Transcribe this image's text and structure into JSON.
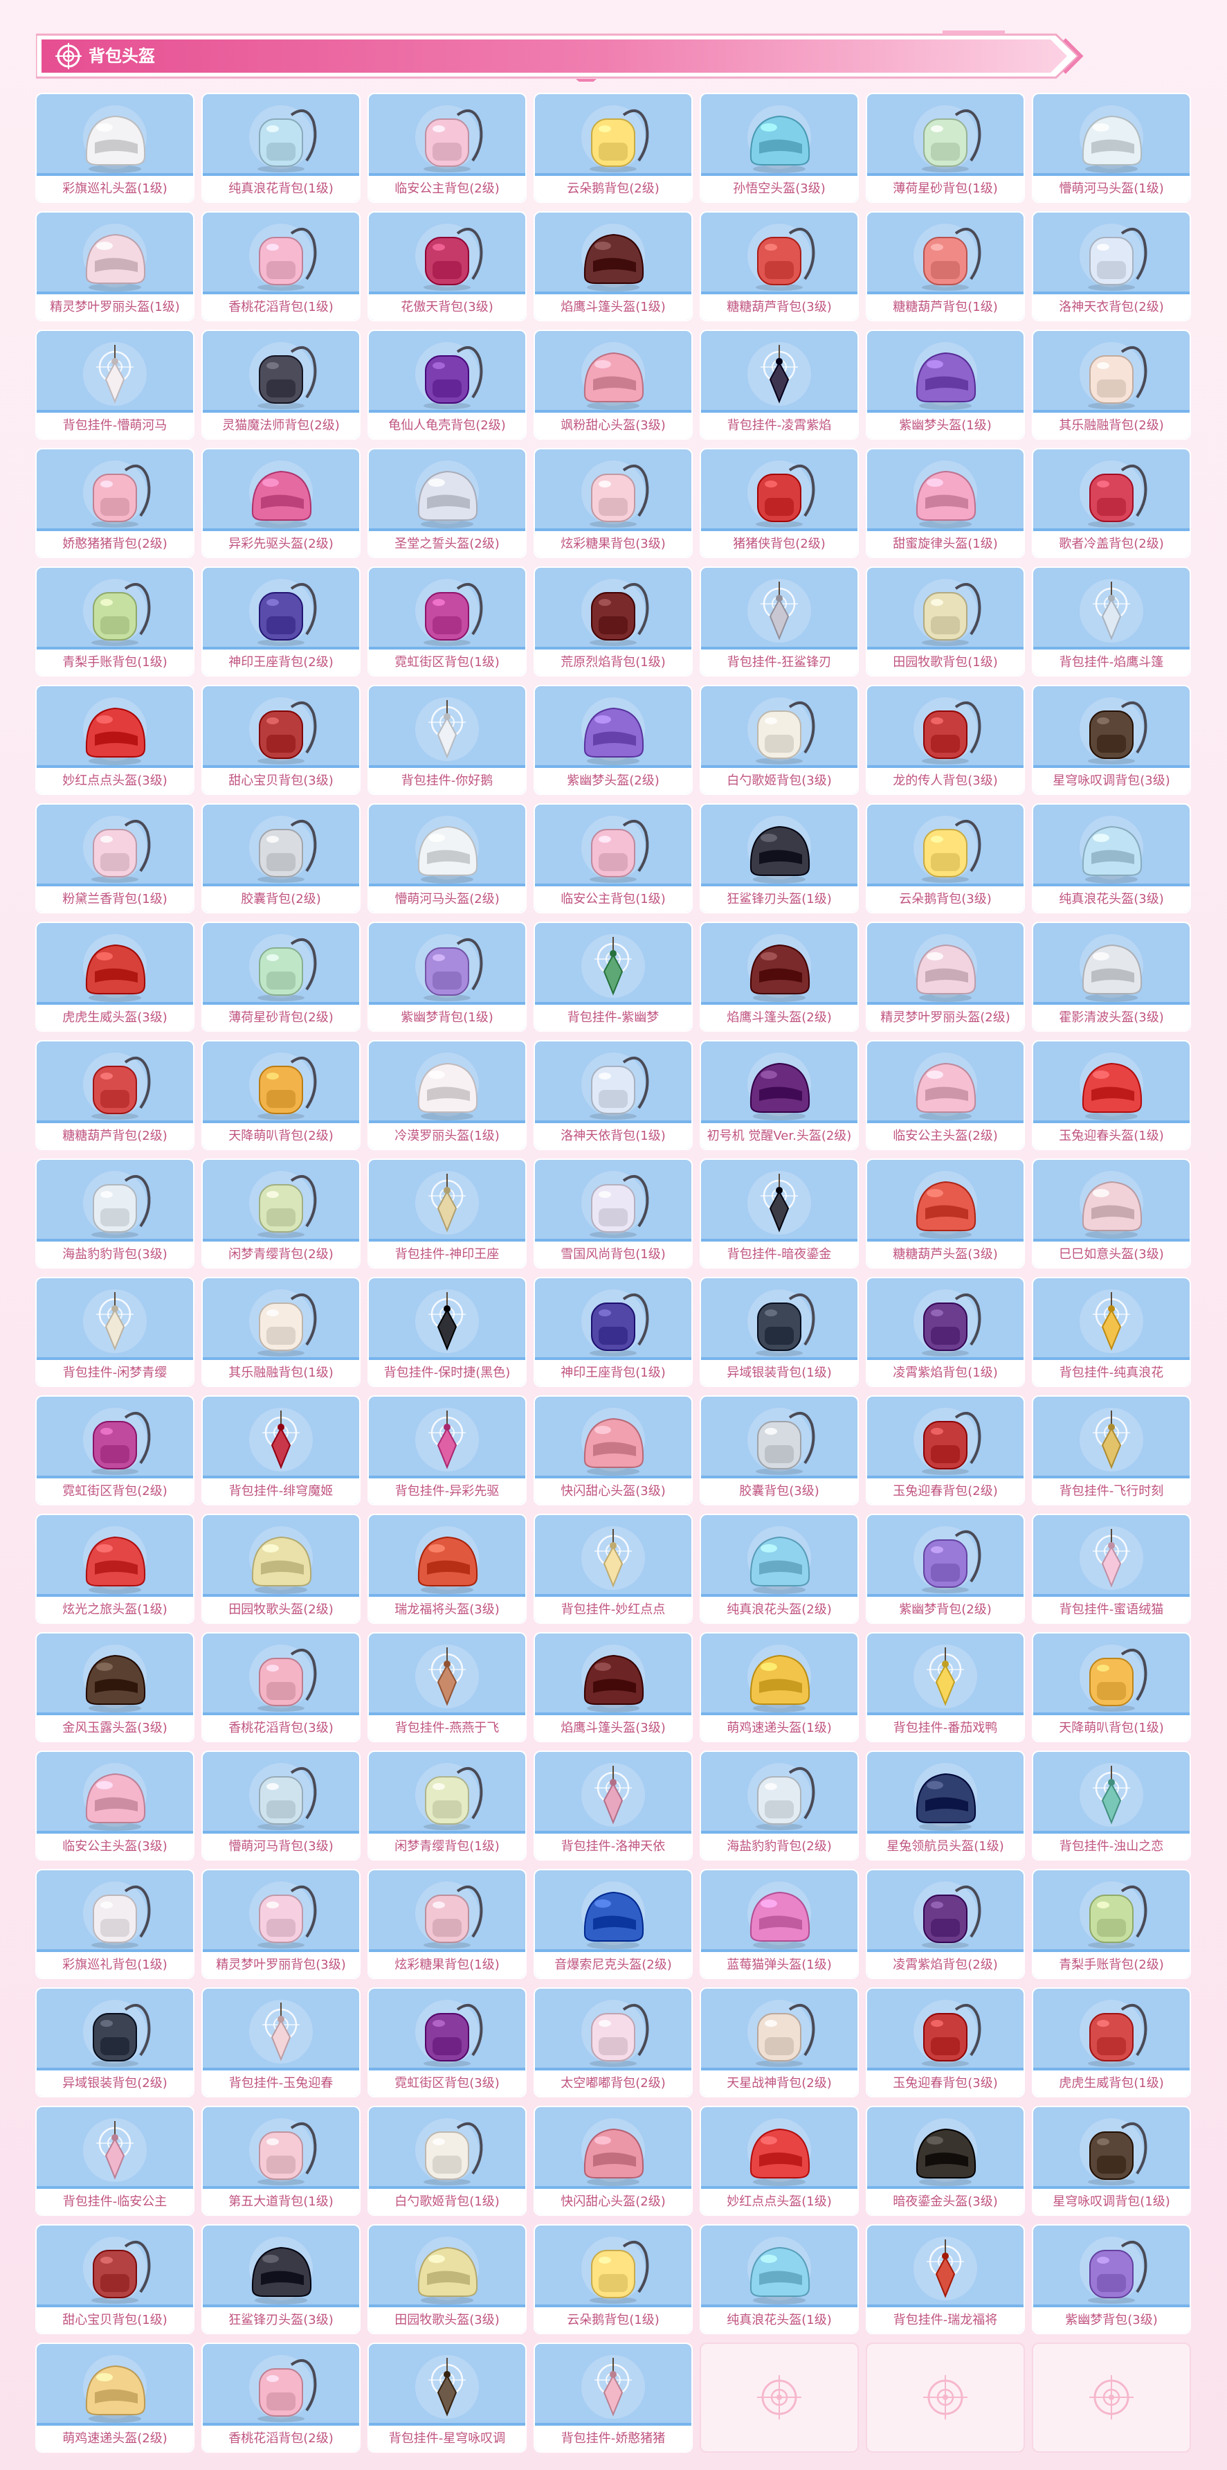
{
  "header": {
    "title": "背包头盔",
    "colors": {
      "accent": "#ee6aa3",
      "accent_light": "#ffd9e8",
      "cell_bg": "#a6cdf2",
      "label_text": "#c0547f"
    }
  },
  "items": [
    {
      "name": "彩旗巡礼头盔(1级)",
      "type": "helmet",
      "color": "#f3f3f5"
    },
    {
      "name": "纯真浪花背包(1级)",
      "type": "backpack",
      "color": "#bfe2f2"
    },
    {
      "name": "临安公主背包(2级)",
      "type": "backpack",
      "color": "#f6c6d8"
    },
    {
      "name": "云朵鹅背包(2级)",
      "type": "backpack",
      "color": "#ffe27a"
    },
    {
      "name": "孙悟空头盔(3级)",
      "type": "helmet",
      "color": "#7fd0e8"
    },
    {
      "name": "薄荷星砂背包(1级)",
      "type": "backpack",
      "color": "#cfeacc"
    },
    {
      "name": "懵萌河马头盔(1级)",
      "type": "helmet",
      "color": "#e8f2f6"
    },
    {
      "name": "精灵梦叶罗丽头盔(1级)",
      "type": "helmet",
      "color": "#f4d9e3"
    },
    {
      "name": "香桃花滔背包(1级)",
      "type": "backpack",
      "color": "#f6b9cf"
    },
    {
      "name": "花傲天背包(3级)",
      "type": "backpack",
      "color": "#c63a6a"
    },
    {
      "name": "焰鹰斗篷头盔(1级)",
      "type": "helmet",
      "color": "#6a2e2e"
    },
    {
      "name": "糖糖葫芦背包(3级)",
      "type": "backpack",
      "color": "#e0554f"
    },
    {
      "name": "糖糖葫芦背包(1级)",
      "type": "backpack",
      "color": "#f08a86"
    },
    {
      "name": "洛神天衣背包(2级)",
      "type": "backpack",
      "color": "#dfe9f7"
    },
    {
      "name": "背包挂件-懵萌河马",
      "type": "charm",
      "color": "#f6eff2"
    },
    {
      "name": "灵猫魔法师背包(2级)",
      "type": "backpack",
      "color": "#4c4c5a"
    },
    {
      "name": "龟仙人龟壳背包(2级)",
      "type": "backpack",
      "color": "#7d3fb0"
    },
    {
      "name": "飒粉甜心头盔(3级)",
      "type": "helmet",
      "color": "#f3a6b8"
    },
    {
      "name": "背包挂件-凌霄紫焰",
      "type": "charm",
      "color": "#3d3450"
    },
    {
      "name": "紫幽梦头盔(1级)",
      "type": "helmet",
      "color": "#8e63cc"
    },
    {
      "name": "其乐融融背包(2级)",
      "type": "backpack",
      "color": "#f7e3d7"
    },
    {
      "name": "娇憨猪猪背包(2级)",
      "type": "backpack",
      "color": "#f6b8c9"
    },
    {
      "name": "异彩先驱头盔(2级)",
      "type": "helmet",
      "color": "#e56aa2"
    },
    {
      "name": "圣堂之誓头盔(2级)",
      "type": "helmet",
      "color": "#dfe3ef"
    },
    {
      "name": "炫彩糖果背包(3级)",
      "type": "backpack",
      "color": "#f7d0d9"
    },
    {
      "name": "猪猪侠背包(2级)",
      "type": "backpack",
      "color": "#d93c3c"
    },
    {
      "name": "甜蜜旋律头盔(1级)",
      "type": "helmet",
      "color": "#f5a9c6"
    },
    {
      "name": "歌者冷盖背包(2级)",
      "type": "backpack",
      "color": "#d9445a"
    },
    {
      "name": "青梨手账背包(1级)",
      "type": "backpack",
      "color": "#c6e0a2"
    },
    {
      "name": "神印王座背包(2级)",
      "type": "backpack",
      "color": "#5a4caa"
    },
    {
      "name": "霓虹街区背包(1级)",
      "type": "backpack",
      "color": "#c54aa1"
    },
    {
      "name": "荒原烈焰背包(1级)",
      "type": "backpack",
      "color": "#7a2a2a"
    },
    {
      "name": "背包挂件-狂鲨锋刃",
      "type": "charm",
      "color": "#c9c7d2"
    },
    {
      "name": "田园牧歌背包(1级)",
      "type": "backpack",
      "color": "#e9e1b9"
    },
    {
      "name": "背包挂件-焰鹰斗篷",
      "type": "charm",
      "color": "#dfe9f4"
    },
    {
      "name": "妙红点点头盔(3级)",
      "type": "helmet",
      "color": "#e23c3c"
    },
    {
      "name": "甜心宝贝背包(3级)",
      "type": "backpack",
      "color": "#b83c3c"
    },
    {
      "name": "背包挂件-你好鹅",
      "type": "charm",
      "color": "#eef2f6"
    },
    {
      "name": "紫幽梦头盔(2级)",
      "type": "helmet",
      "color": "#8f6ad4"
    },
    {
      "name": "白勺歌姬背包(3级)",
      "type": "backpack",
      "color": "#f4efe4"
    },
    {
      "name": "龙的传人背包(3级)",
      "type": "backpack",
      "color": "#c73d3d"
    },
    {
      "name": "星穹咏叹调背包(3级)",
      "type": "backpack",
      "color": "#5b4638"
    },
    {
      "name": "粉黛兰香背包(1级)",
      "type": "backpack",
      "color": "#f6d1e0"
    },
    {
      "name": "胶囊背包(2级)",
      "type": "backpack",
      "color": "#d9dde2"
    },
    {
      "name": "懵萌河马头盔(2级)",
      "type": "helmet",
      "color": "#f1f4f6"
    },
    {
      "name": "临安公主背包(1级)",
      "type": "backpack",
      "color": "#f6c0d4"
    },
    {
      "name": "狂鲨锋刃头盔(1级)",
      "type": "helmet",
      "color": "#3a3a46"
    },
    {
      "name": "云朵鹅背包(3级)",
      "type": "backpack",
      "color": "#ffe27a"
    },
    {
      "name": "纯真浪花头盔(3级)",
      "type": "helmet",
      "color": "#bfe3f4"
    },
    {
      "name": "虎虎生威头盔(3级)",
      "type": "helmet",
      "color": "#d8403a"
    },
    {
      "name": "薄荷星砂背包(2级)",
      "type": "backpack",
      "color": "#bfe6c7"
    },
    {
      "name": "紫幽梦背包(1级)",
      "type": "backpack",
      "color": "#a98bdd"
    },
    {
      "name": "背包挂件-紫幽梦",
      "type": "charm",
      "color": "#5da874"
    },
    {
      "name": "焰鹰斗篷头盔(2级)",
      "type": "helmet",
      "color": "#7a2a2a"
    },
    {
      "name": "精灵梦叶罗丽头盔(2级)",
      "type": "helmet",
      "color": "#f2d4e1"
    },
    {
      "name": "霍影清波头盔(3级)",
      "type": "helmet",
      "color": "#e4e7ec"
    },
    {
      "name": "糖糖葫芦背包(2级)",
      "type": "backpack",
      "color": "#d84c4c"
    },
    {
      "name": "天降萌叭背包(2级)",
      "type": "backpack",
      "color": "#f2b44a"
    },
    {
      "name": "冷漠罗丽头盔(1级)",
      "type": "helmet",
      "color": "#f7f1f4"
    },
    {
      "name": "洛神天依背包(1级)",
      "type": "backpack",
      "color": "#dfe9f7"
    },
    {
      "name": "初号机 觉醒Ver.头盔(2级)",
      "type": "helmet",
      "color": "#6a2a7e"
    },
    {
      "name": "临安公主头盔(2级)",
      "type": "helmet",
      "color": "#f6c0d2"
    },
    {
      "name": "玉兔迎春头盔(1级)",
      "type": "helmet",
      "color": "#e84343"
    },
    {
      "name": "海盐豹豹背包(3级)",
      "type": "backpack",
      "color": "#e7eef4"
    },
    {
      "name": "闲梦青缨背包(2级)",
      "type": "backpack",
      "color": "#d8e6b9"
    },
    {
      "name": "背包挂件-神印王座",
      "type": "charm",
      "color": "#e7d7a7"
    },
    {
      "name": "雪国风尚背包(1级)",
      "type": "backpack",
      "color": "#ece7f6"
    },
    {
      "name": "背包挂件-暗夜鎏金",
      "type": "charm",
      "color": "#3c3c46"
    },
    {
      "name": "糖糖葫芦头盔(3级)",
      "type": "helmet",
      "color": "#e65b4c"
    },
    {
      "name": "巳巳如意头盔(3级)",
      "type": "helmet",
      "color": "#f1d2d8"
    },
    {
      "name": "背包挂件-闲梦青缨",
      "type": "charm",
      "color": "#f1e9d8"
    },
    {
      "name": "其乐融融背包(1级)",
      "type": "backpack",
      "color": "#f6ece2"
    },
    {
      "name": "背包挂件-保时捷(黑色)",
      "type": "charm",
      "color": "#2f2f36"
    },
    {
      "name": "神印王座背包(1级)",
      "type": "backpack",
      "color": "#5247a6"
    },
    {
      "name": "异域银装背包(1级)",
      "type": "backpack",
      "color": "#3d4656"
    },
    {
      "name": "凌霄紫焰背包(1级)",
      "type": "backpack",
      "color": "#6c3d8e"
    },
    {
      "name": "背包挂件-纯真浪花",
      "type": "charm",
      "color": "#f3c24a"
    },
    {
      "name": "霓虹街区背包(2级)",
      "type": "backpack",
      "color": "#c04a9e"
    },
    {
      "name": "背包挂件-绯穹魔姬",
      "type": "charm",
      "color": "#c8374a"
    },
    {
      "name": "背包挂件-异彩先驱",
      "type": "charm",
      "color": "#e060a6"
    },
    {
      "name": "快闪甜心头盔(3级)",
      "type": "helmet",
      "color": "#f0a0ae"
    },
    {
      "name": "胶囊背包(3级)",
      "type": "backpack",
      "color": "#d6dbe1"
    },
    {
      "name": "玉兔迎春背包(2级)",
      "type": "backpack",
      "color": "#c43a3a"
    },
    {
      "name": "背包挂件-飞行时刻",
      "type": "charm",
      "color": "#e3c36a"
    },
    {
      "name": "炫光之旅头盔(1级)",
      "type": "helmet",
      "color": "#e44646"
    },
    {
      "name": "田园牧歌头盔(2级)",
      "type": "helmet",
      "color": "#e9e1a9"
    },
    {
      "name": "瑞龙福将头盔(3级)",
      "type": "helmet",
      "color": "#e0593f"
    },
    {
      "name": "背包挂件-妙红点点",
      "type": "charm",
      "color": "#f6e2a6"
    },
    {
      "name": "纯真浪花头盔(2级)",
      "type": "helmet",
      "color": "#8fd3ee"
    },
    {
      "name": "紫幽梦背包(2级)",
      "type": "backpack",
      "color": "#9a7ad8"
    },
    {
      "name": "背包挂件-蜜语绒猫",
      "type": "charm",
      "color": "#f6c7db"
    },
    {
      "name": "金风玉露头盔(3级)",
      "type": "helmet",
      "color": "#5a4030"
    },
    {
      "name": "香桃花滔背包(3级)",
      "type": "backpack",
      "color": "#f4b4c6"
    },
    {
      "name": "背包挂件-燕燕于飞",
      "type": "charm",
      "color": "#c98a6a"
    },
    {
      "name": "焰鹰斗篷头盔(3级)",
      "type": "helmet",
      "color": "#6d2424"
    },
    {
      "name": "萌鸡速递头盔(1级)",
      "type": "helmet",
      "color": "#f2c449"
    },
    {
      "name": "背包挂件-番茄戏鸭",
      "type": "charm",
      "color": "#f8d65a"
    },
    {
      "name": "天降萌叭背包(1级)",
      "type": "backpack",
      "color": "#f5bd52"
    },
    {
      "name": "临安公主头盔(3级)",
      "type": "helmet",
      "color": "#f5b6cc"
    },
    {
      "name": "懵萌河马背包(3级)",
      "type": "backpack",
      "color": "#cfe3ef"
    },
    {
      "name": "闲梦青缨背包(1级)",
      "type": "backpack",
      "color": "#e5ebc4"
    },
    {
      "name": "背包挂件-洛神天依",
      "type": "charm",
      "color": "#e9a7bf"
    },
    {
      "name": "海盐豹豹背包(2级)",
      "type": "backpack",
      "color": "#e4ecf3"
    },
    {
      "name": "星兔领航员头盔(1级)",
      "type": "helmet",
      "color": "#2f3f6f"
    },
    {
      "name": "背包挂件-浊山之恋",
      "type": "charm",
      "color": "#79c7b6"
    },
    {
      "name": "彩旗巡礼背包(1级)",
      "type": "backpack",
      "color": "#f3eef2"
    },
    {
      "name": "精灵梦叶罗丽背包(3级)",
      "type": "backpack",
      "color": "#f6d0e0"
    },
    {
      "name": "炫彩糖果背包(1级)",
      "type": "backpack",
      "color": "#f2c6d3"
    },
    {
      "name": "音爆索尼克头盔(2级)",
      "type": "helmet",
      "color": "#2f5fc6"
    },
    {
      "name": "蓝莓猫弹头盔(1级)",
      "type": "helmet",
      "color": "#e984c9"
    },
    {
      "name": "凌霄紫焰背包(2级)",
      "type": "backpack",
      "color": "#6b3b8a"
    },
    {
      "name": "青梨手账背包(2级)",
      "type": "backpack",
      "color": "#c7e0a1"
    },
    {
      "name": "异域银装背包(2级)",
      "type": "backpack",
      "color": "#3c4454"
    },
    {
      "name": "背包挂件-玉兔迎春",
      "type": "charm",
      "color": "#f2d4d9"
    },
    {
      "name": "霓虹街区背包(3级)",
      "type": "backpack",
      "color": "#8a3c9e"
    },
    {
      "name": "太空嘟嘟背包(2级)",
      "type": "backpack",
      "color": "#f6dbe8"
    },
    {
      "name": "天星战神背包(2级)",
      "type": "backpack",
      "color": "#f0e0d4"
    },
    {
      "name": "玉兔迎春背包(3级)",
      "type": "backpack",
      "color": "#c83c3c"
    },
    {
      "name": "虎虎生威背包(1级)",
      "type": "backpack",
      "color": "#d64a4a"
    },
    {
      "name": "背包挂件-临安公主",
      "type": "charm",
      "color": "#f0b6cc"
    },
    {
      "name": "第五大道背包(1级)",
      "type": "backpack",
      "color": "#f6cbd6"
    },
    {
      "name": "白勺歌姬背包(1级)",
      "type": "backpack",
      "color": "#f4efe6"
    },
    {
      "name": "快闪甜心头盔(2级)",
      "type": "helmet",
      "color": "#ec97a8"
    },
    {
      "name": "妙红点点头盔(1级)",
      "type": "helmet",
      "color": "#e84444"
    },
    {
      "name": "暗夜鎏金头盔(3级)",
      "type": "helmet",
      "color": "#3a342e"
    },
    {
      "name": "星穹咏叹调背包(1级)",
      "type": "backpack",
      "color": "#5a4638"
    },
    {
      "name": "甜心宝贝背包(1级)",
      "type": "backpack",
      "color": "#b54242"
    },
    {
      "name": "狂鲨锋刃头盔(3级)",
      "type": "helmet",
      "color": "#3a3a46"
    },
    {
      "name": "田园牧歌头盔(3级)",
      "type": "helmet",
      "color": "#ebe0a4"
    },
    {
      "name": "云朵鹅背包(1级)",
      "type": "backpack",
      "color": "#ffe282"
    },
    {
      "name": "纯真浪花头盔(1级)",
      "type": "helmet",
      "color": "#8fd5ef"
    },
    {
      "name": "背包挂件-瑞龙福将",
      "type": "charm",
      "color": "#d9503e"
    },
    {
      "name": "紫幽梦背包(3级)",
      "type": "backpack",
      "color": "#9b78d6"
    },
    {
      "name": "萌鸡速递头盔(2级)",
      "type": "helmet",
      "color": "#f3d28b"
    },
    {
      "name": "香桃花滔背包(2级)",
      "type": "backpack",
      "color": "#f5b7c9"
    },
    {
      "name": "背包挂件-星穹咏叹调",
      "type": "charm",
      "color": "#6d5a48"
    },
    {
      "name": "背包挂件-娇憨猪猪",
      "type": "charm",
      "color": "#f2b8c8"
    }
  ],
  "empty_slots": 3
}
